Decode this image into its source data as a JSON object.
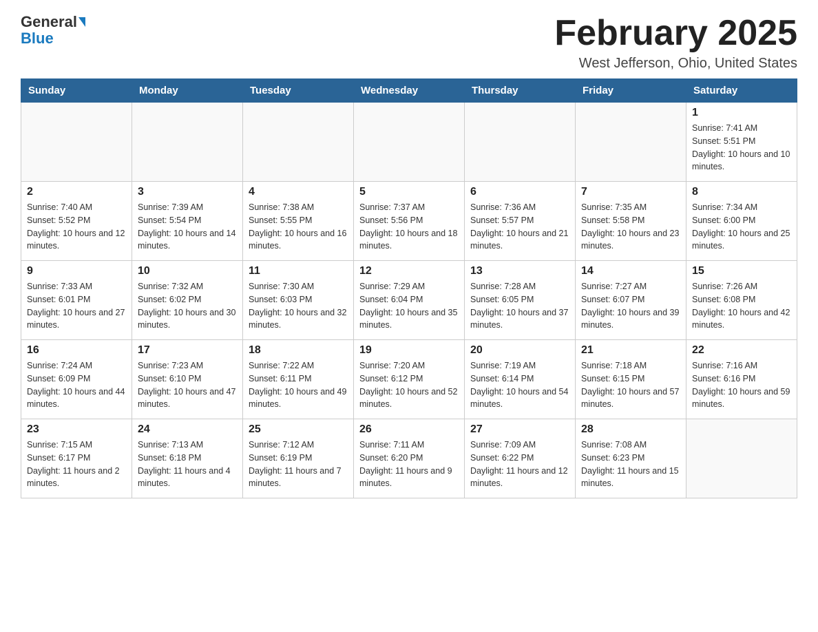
{
  "header": {
    "logo_general": "General",
    "logo_blue": "Blue",
    "month_title": "February 2025",
    "location": "West Jefferson, Ohio, United States"
  },
  "days_of_week": [
    "Sunday",
    "Monday",
    "Tuesday",
    "Wednesday",
    "Thursday",
    "Friday",
    "Saturday"
  ],
  "weeks": [
    [
      {
        "day": "",
        "sunrise": "",
        "sunset": "",
        "daylight": ""
      },
      {
        "day": "",
        "sunrise": "",
        "sunset": "",
        "daylight": ""
      },
      {
        "day": "",
        "sunrise": "",
        "sunset": "",
        "daylight": ""
      },
      {
        "day": "",
        "sunrise": "",
        "sunset": "",
        "daylight": ""
      },
      {
        "day": "",
        "sunrise": "",
        "sunset": "",
        "daylight": ""
      },
      {
        "day": "",
        "sunrise": "",
        "sunset": "",
        "daylight": ""
      },
      {
        "day": "1",
        "sunrise": "Sunrise: 7:41 AM",
        "sunset": "Sunset: 5:51 PM",
        "daylight": "Daylight: 10 hours and 10 minutes."
      }
    ],
    [
      {
        "day": "2",
        "sunrise": "Sunrise: 7:40 AM",
        "sunset": "Sunset: 5:52 PM",
        "daylight": "Daylight: 10 hours and 12 minutes."
      },
      {
        "day": "3",
        "sunrise": "Sunrise: 7:39 AM",
        "sunset": "Sunset: 5:54 PM",
        "daylight": "Daylight: 10 hours and 14 minutes."
      },
      {
        "day": "4",
        "sunrise": "Sunrise: 7:38 AM",
        "sunset": "Sunset: 5:55 PM",
        "daylight": "Daylight: 10 hours and 16 minutes."
      },
      {
        "day": "5",
        "sunrise": "Sunrise: 7:37 AM",
        "sunset": "Sunset: 5:56 PM",
        "daylight": "Daylight: 10 hours and 18 minutes."
      },
      {
        "day": "6",
        "sunrise": "Sunrise: 7:36 AM",
        "sunset": "Sunset: 5:57 PM",
        "daylight": "Daylight: 10 hours and 21 minutes."
      },
      {
        "day": "7",
        "sunrise": "Sunrise: 7:35 AM",
        "sunset": "Sunset: 5:58 PM",
        "daylight": "Daylight: 10 hours and 23 minutes."
      },
      {
        "day": "8",
        "sunrise": "Sunrise: 7:34 AM",
        "sunset": "Sunset: 6:00 PM",
        "daylight": "Daylight: 10 hours and 25 minutes."
      }
    ],
    [
      {
        "day": "9",
        "sunrise": "Sunrise: 7:33 AM",
        "sunset": "Sunset: 6:01 PM",
        "daylight": "Daylight: 10 hours and 27 minutes."
      },
      {
        "day": "10",
        "sunrise": "Sunrise: 7:32 AM",
        "sunset": "Sunset: 6:02 PM",
        "daylight": "Daylight: 10 hours and 30 minutes."
      },
      {
        "day": "11",
        "sunrise": "Sunrise: 7:30 AM",
        "sunset": "Sunset: 6:03 PM",
        "daylight": "Daylight: 10 hours and 32 minutes."
      },
      {
        "day": "12",
        "sunrise": "Sunrise: 7:29 AM",
        "sunset": "Sunset: 6:04 PM",
        "daylight": "Daylight: 10 hours and 35 minutes."
      },
      {
        "day": "13",
        "sunrise": "Sunrise: 7:28 AM",
        "sunset": "Sunset: 6:05 PM",
        "daylight": "Daylight: 10 hours and 37 minutes."
      },
      {
        "day": "14",
        "sunrise": "Sunrise: 7:27 AM",
        "sunset": "Sunset: 6:07 PM",
        "daylight": "Daylight: 10 hours and 39 minutes."
      },
      {
        "day": "15",
        "sunrise": "Sunrise: 7:26 AM",
        "sunset": "Sunset: 6:08 PM",
        "daylight": "Daylight: 10 hours and 42 minutes."
      }
    ],
    [
      {
        "day": "16",
        "sunrise": "Sunrise: 7:24 AM",
        "sunset": "Sunset: 6:09 PM",
        "daylight": "Daylight: 10 hours and 44 minutes."
      },
      {
        "day": "17",
        "sunrise": "Sunrise: 7:23 AM",
        "sunset": "Sunset: 6:10 PM",
        "daylight": "Daylight: 10 hours and 47 minutes."
      },
      {
        "day": "18",
        "sunrise": "Sunrise: 7:22 AM",
        "sunset": "Sunset: 6:11 PM",
        "daylight": "Daylight: 10 hours and 49 minutes."
      },
      {
        "day": "19",
        "sunrise": "Sunrise: 7:20 AM",
        "sunset": "Sunset: 6:12 PM",
        "daylight": "Daylight: 10 hours and 52 minutes."
      },
      {
        "day": "20",
        "sunrise": "Sunrise: 7:19 AM",
        "sunset": "Sunset: 6:14 PM",
        "daylight": "Daylight: 10 hours and 54 minutes."
      },
      {
        "day": "21",
        "sunrise": "Sunrise: 7:18 AM",
        "sunset": "Sunset: 6:15 PM",
        "daylight": "Daylight: 10 hours and 57 minutes."
      },
      {
        "day": "22",
        "sunrise": "Sunrise: 7:16 AM",
        "sunset": "Sunset: 6:16 PM",
        "daylight": "Daylight: 10 hours and 59 minutes."
      }
    ],
    [
      {
        "day": "23",
        "sunrise": "Sunrise: 7:15 AM",
        "sunset": "Sunset: 6:17 PM",
        "daylight": "Daylight: 11 hours and 2 minutes."
      },
      {
        "day": "24",
        "sunrise": "Sunrise: 7:13 AM",
        "sunset": "Sunset: 6:18 PM",
        "daylight": "Daylight: 11 hours and 4 minutes."
      },
      {
        "day": "25",
        "sunrise": "Sunrise: 7:12 AM",
        "sunset": "Sunset: 6:19 PM",
        "daylight": "Daylight: 11 hours and 7 minutes."
      },
      {
        "day": "26",
        "sunrise": "Sunrise: 7:11 AM",
        "sunset": "Sunset: 6:20 PM",
        "daylight": "Daylight: 11 hours and 9 minutes."
      },
      {
        "day": "27",
        "sunrise": "Sunrise: 7:09 AM",
        "sunset": "Sunset: 6:22 PM",
        "daylight": "Daylight: 11 hours and 12 minutes."
      },
      {
        "day": "28",
        "sunrise": "Sunrise: 7:08 AM",
        "sunset": "Sunset: 6:23 PM",
        "daylight": "Daylight: 11 hours and 15 minutes."
      },
      {
        "day": "",
        "sunrise": "",
        "sunset": "",
        "daylight": ""
      }
    ]
  ]
}
